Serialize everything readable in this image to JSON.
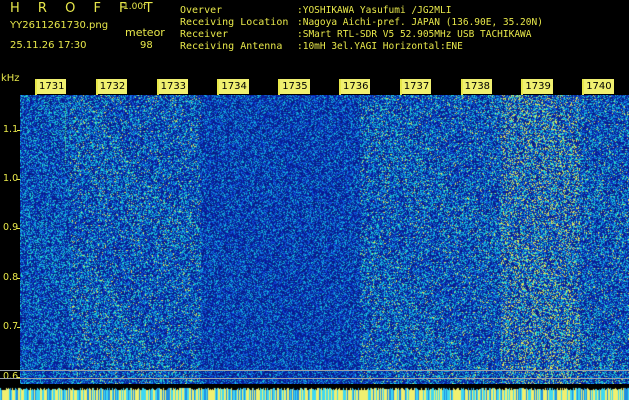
{
  "header": {
    "logo": "H R O F F T",
    "version": "1.00f",
    "filename": "YY2611261730.png",
    "meteor_label": "meteor",
    "timestamp": "25.11.26 17:30",
    "meteor_count": "98"
  },
  "info": [
    {
      "key": "Overver",
      "value": ":YOSHIKAWA Yasufumi /JG2MLI"
    },
    {
      "key": "Receiving Location",
      "value": ":Nagoya Aichi-pref. JAPAN (136.90E, 35.20N)"
    },
    {
      "key": "Receiver",
      "value": ":SMart RTL-SDR V5 52.905MHz USB TACHIKAWA"
    },
    {
      "key": "Receiving Antenna",
      "value": ":10mH 3el.YAGI Horizontal:ENE"
    }
  ],
  "axis": {
    "unit": "kHz",
    "yticks": [
      {
        "label": "1.1",
        "value": 1.1
      },
      {
        "label": "1.0",
        "value": 1.0
      },
      {
        "label": "0.9",
        "value": 0.9
      },
      {
        "label": "0.8",
        "value": 0.8
      },
      {
        "label": "0.7",
        "value": 0.7
      },
      {
        "label": "0.6",
        "value": 0.6
      }
    ],
    "ylim": [
      0.585,
      1.17
    ],
    "time_marks": [
      "1731",
      "1732",
      "1733",
      "1734",
      "1735",
      "1736",
      "1737",
      "1738",
      "1739",
      "1740"
    ]
  },
  "colors": {
    "label": "#e8e84a",
    "background": "#000000",
    "spectrum_low": "#0a1f9c",
    "spectrum_mid": "#1f8fe0",
    "spectrum_high": "#38e0c8",
    "spectrum_peak": "#f0f070"
  }
}
